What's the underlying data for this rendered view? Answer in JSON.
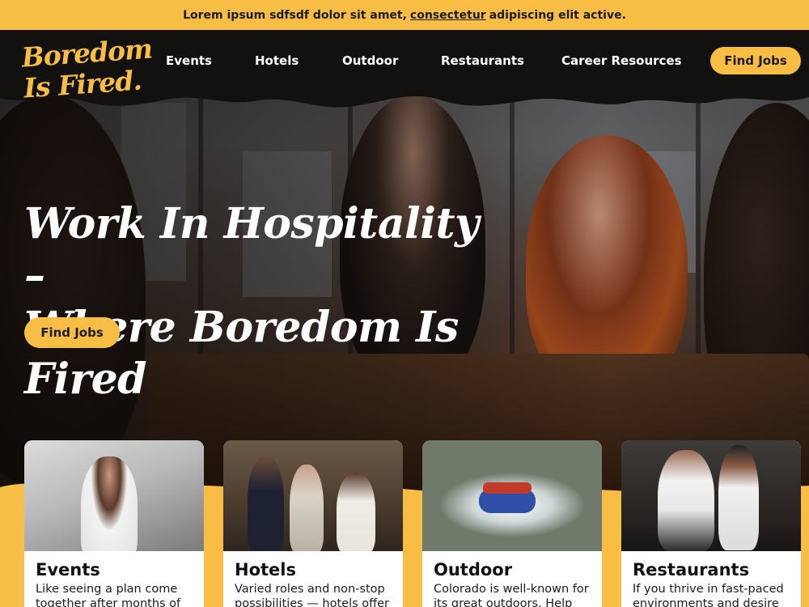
{
  "announcement": {
    "before": "Lorem ipsum sdfsdf dolor sit amet,",
    "link": "consectetur",
    "after": "adipiscing elit active."
  },
  "logo": {
    "line1": "Boredom",
    "line2": "Is Fired."
  },
  "nav": {
    "links": [
      "Events",
      "Hotels",
      "Outdoor",
      "Restaurants",
      "Career Resources"
    ],
    "cta": "Find Jobs"
  },
  "hero": {
    "title_line1": "Work In Hospitality –",
    "title_line2": "Where Boredom Is Fired",
    "cta": "Find Jobs"
  },
  "cards": [
    {
      "title": "Events",
      "text": "Like seeing a plan come together after months of"
    },
    {
      "title": "Hotels",
      "text": "Varied roles and non-stop possibilities — hotels offer"
    },
    {
      "title": "Outdoor",
      "text": "Colorado is well-known for its great outdoors. Help"
    },
    {
      "title": "Restaurants",
      "text": "If you thrive in fast-paced environments and desire"
    }
  ],
  "colors": {
    "accent": "#f8bd45",
    "dark": "#121110"
  }
}
